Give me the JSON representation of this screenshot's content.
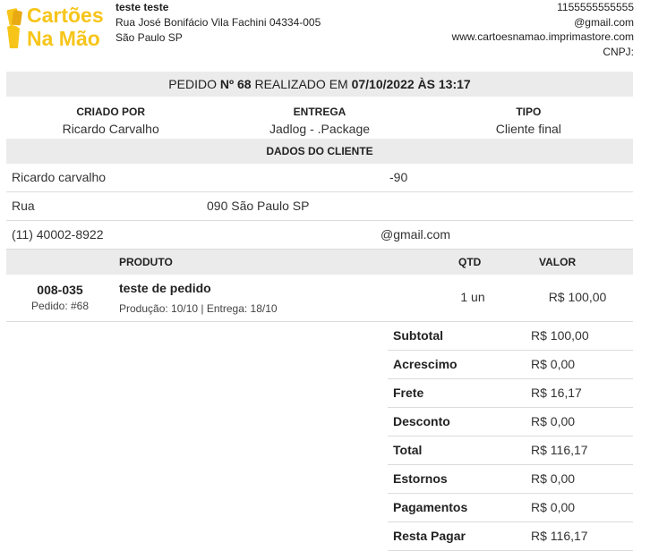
{
  "brand": {
    "logo_line1": "Cartões",
    "logo_line2": "Na Mão",
    "accent": "#f7c51a"
  },
  "company": {
    "name": "teste teste",
    "address": "Rua José Bonifácio Vila Fachini 04334-005 São Paulo SP"
  },
  "contact": {
    "phone": "1155555555555",
    "email": "@gmail.com",
    "website": "www.cartoesnamao.imprimastore.com",
    "cnpj": "CNPJ:"
  },
  "order": {
    "prefix": "PEDIDO",
    "number": "Nº 68",
    "middle": "REALIZADO EM",
    "datetime": "07/10/2022 ÀS 13:17"
  },
  "info": [
    {
      "label": "CRIADO POR",
      "value": "Ricardo Carvalho"
    },
    {
      "label": "ENTREGA",
      "value": "Jadlog - .Package"
    },
    {
      "label": "TIPO",
      "value": "Cliente final"
    }
  ],
  "client": {
    "title": "DADOS DO CLIENTE",
    "name": "Ricardo carvalho",
    "doc": "-90",
    "street": "Rua",
    "city": "090 São Paulo SP",
    "phone": "(11) 40002-8922",
    "email": "@gmail.com"
  },
  "products": {
    "headers": {
      "product": "PRODUTO",
      "qty": "QTD",
      "value": "VALOR"
    },
    "items": [
      {
        "code": "008-035",
        "order_ref": "Pedido: #68",
        "name": "teste de pedido",
        "dates": "Produção: 10/10 | Entrega: 18/10",
        "qty": "1 un",
        "price": "R$ 100,00"
      }
    ]
  },
  "totals": [
    {
      "label": "Subtotal",
      "value": "R$ 100,00"
    },
    {
      "label": "Acrescimo",
      "value": "R$ 0,00"
    },
    {
      "label": "Frete",
      "value": "R$ 16,17"
    },
    {
      "label": "Desconto",
      "value": "R$ 0,00"
    },
    {
      "label": "Total",
      "value": "R$ 116,17"
    },
    {
      "label": "Estornos",
      "value": "R$ 0,00"
    },
    {
      "label": "Pagamentos",
      "value": "R$ 0,00"
    },
    {
      "label": "Resta Pagar",
      "value": "R$ 116,17"
    }
  ]
}
